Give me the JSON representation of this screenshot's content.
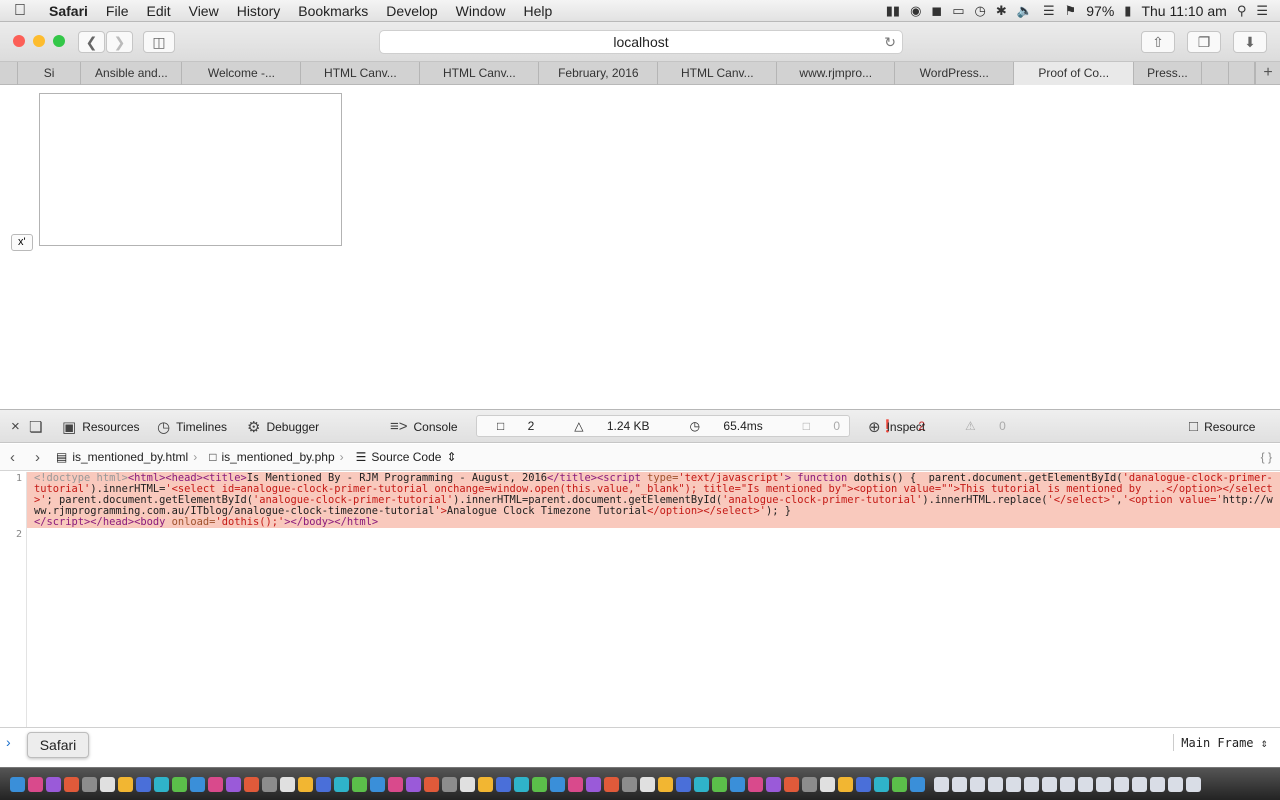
{
  "menubar": {
    "app": "Safari",
    "items": [
      "File",
      "Edit",
      "View",
      "History",
      "Bookmarks",
      "Develop",
      "Window",
      "Help"
    ],
    "battery": "97%",
    "clock": "Thu 11:10 am"
  },
  "toolbar": {
    "address": "localhost"
  },
  "tabs": [
    {
      "label": "Si",
      "w": 64
    },
    {
      "label": "Ansible and...",
      "w": 102
    },
    {
      "label": "Welcome -...",
      "w": 120
    },
    {
      "label": "HTML Canv...",
      "w": 120
    },
    {
      "label": "HTML Canv...",
      "w": 120
    },
    {
      "label": "February, 2016",
      "w": 120
    },
    {
      "label": "HTML Canv...",
      "w": 120
    },
    {
      "label": "www.rjmpro...",
      "w": 119
    },
    {
      "label": "WordPress...",
      "w": 120
    },
    {
      "label": "Proof of Co...",
      "w": 121
    },
    {
      "label": "Press...",
      "w": 68
    }
  ],
  "page": {
    "x_button": "x'"
  },
  "inspector": {
    "tabs": {
      "resources": "Resources",
      "timelines": "Timelines",
      "debugger": "Debugger",
      "console": "Console",
      "inspect": "Inspect",
      "resource": "Resource"
    },
    "stats": {
      "resources": "2",
      "size": "1.24 KB",
      "time": "65.4ms",
      "logs": "0",
      "errors": "2",
      "warnings": "0"
    },
    "breadcrumbs": [
      "is_mentioned_by.html",
      "is_mentioned_by.php",
      "Source Code"
    ],
    "line_numbers": [
      "1",
      "2"
    ],
    "console": {
      "frame": "Main Frame"
    }
  },
  "tooltip": "Safari",
  "colors": {
    "error_highlight": "#f9c9bd",
    "close": "#fc5f57",
    "minimize": "#fdbc2e",
    "zoom": "#33c748",
    "error_red": "#c52a2a"
  }
}
